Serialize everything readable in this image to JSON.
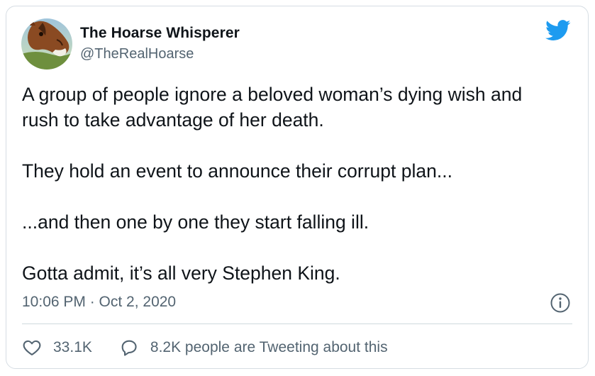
{
  "tweet": {
    "display_name": "The Hoarse Whisperer",
    "handle": "@TheRealHoarse",
    "avatar_icon": "horse-avatar",
    "paragraphs": [
      "A group of people ignore a beloved woman’s dying wish and\nrush to take advantage of her death.",
      "They hold an event to announce their corrupt plan...",
      "...and then one by one they start falling ill.",
      "Gotta admit, it’s all very Stephen King."
    ],
    "timestamp": "10:06 PM · Oct 2, 2020",
    "likes": "33.1K",
    "conversation": "8.2K people are Tweeting about this"
  },
  "icons": {
    "brand": "twitter-bird-icon",
    "info": "info-icon",
    "like": "heart-icon",
    "reply": "speech-bubble-icon"
  },
  "colors": {
    "brand_blue": "#1d9bf0",
    "text_primary": "#0f1419",
    "text_secondary": "#536471",
    "border": "#d6dde3"
  }
}
